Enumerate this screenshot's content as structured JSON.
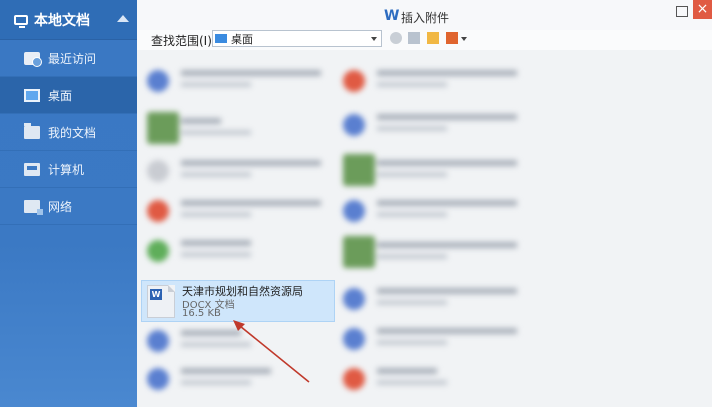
{
  "sidebar": {
    "title": "本地文档",
    "items": [
      {
        "label": "最近访问",
        "icon": "clock-icon"
      },
      {
        "label": "桌面",
        "icon": "desktop-icon"
      },
      {
        "label": "我的文档",
        "icon": "folder-icon"
      },
      {
        "label": "计算机",
        "icon": "computer-icon"
      },
      {
        "label": "网络",
        "icon": "network-icon"
      }
    ]
  },
  "dialog": {
    "title": "插入附件",
    "logo": "W",
    "close": "×"
  },
  "toolbar": {
    "scope_label": "查找范围(I):",
    "scope_value": "桌面"
  },
  "selected_file": {
    "name": "天津市规划和自然资源局",
    "type": "DOCX 文档",
    "size": "16.5 KB",
    "icon_letter": "W"
  },
  "colors": {
    "sidebar_bg": "#3b79c4",
    "selected_bg": "#cfe6fb",
    "close_btn": "#e05a43",
    "arrow": "#c0392b"
  }
}
